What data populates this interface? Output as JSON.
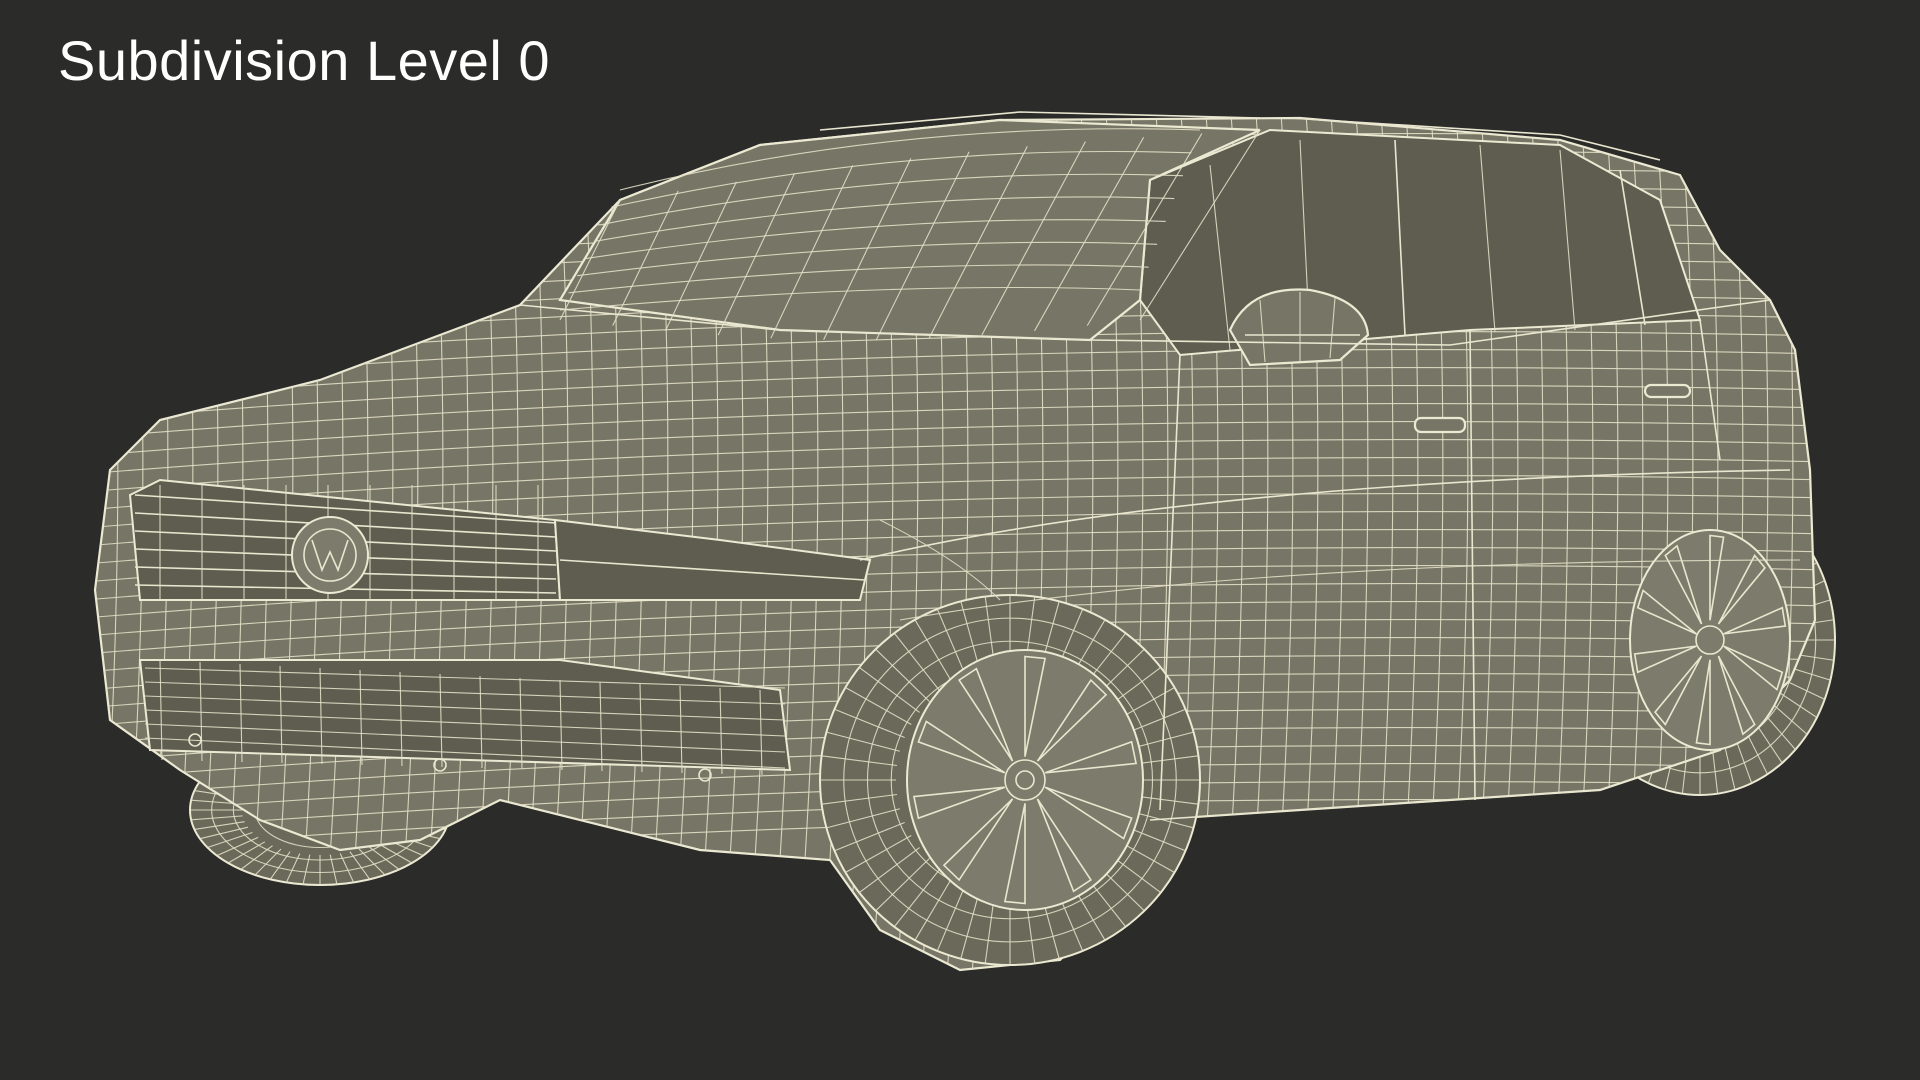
{
  "caption": {
    "text": "Subdivision Level 0"
  },
  "colors": {
    "background": "#2b2b2a",
    "mesh_surface": "#777565",
    "wireframe": "#e9e6cf",
    "caption_text": "#ffffff"
  }
}
